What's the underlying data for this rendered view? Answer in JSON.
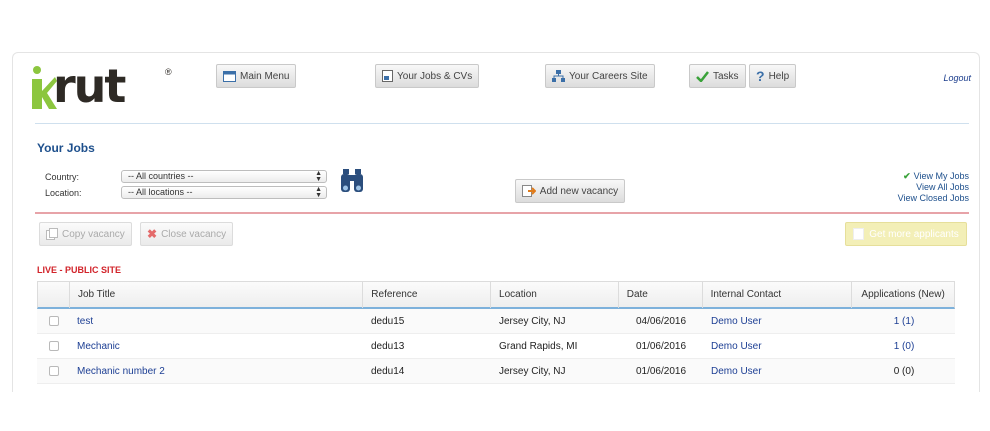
{
  "brand": {
    "logo_text": "rut",
    "logo_mark": "ik",
    "registered": "®"
  },
  "nav": {
    "main_menu": "Main Menu",
    "your_jobs": "Your Jobs & CVs",
    "careers_site": "Your Careers Site",
    "tasks": "Tasks",
    "help": "Help",
    "logout": "Logout"
  },
  "page": {
    "title": "Your Jobs"
  },
  "filters": {
    "country_label": "Country:",
    "country_value": "-- All countries --",
    "location_label": "Location:",
    "location_value": "-- All locations --"
  },
  "actions": {
    "add_new": "Add new vacancy",
    "copy": "Copy vacancy",
    "close": "Close vacancy",
    "get_more": "Get more applicants"
  },
  "links": {
    "view_my": "View My Jobs",
    "view_all": "View All Jobs",
    "view_closed": "View Closed Jobs"
  },
  "section": {
    "label": "LIVE - PUBLIC SITE"
  },
  "table": {
    "headers": [
      "Job Title",
      "Reference",
      "Location",
      "Date",
      "Internal Contact",
      "Applications (New)"
    ],
    "rows": [
      {
        "title": "test",
        "reference": "dedu15",
        "location": "Jersey City, NJ",
        "date": "04/06/2016",
        "contact": "Demo User",
        "applications": "1 (1)"
      },
      {
        "title": "Mechanic",
        "reference": "dedu13",
        "location": "Grand Rapids, MI",
        "date": "01/06/2016",
        "contact": "Demo User",
        "applications": "1 (0)"
      },
      {
        "title": "Mechanic number 2",
        "reference": "dedu14",
        "location": "Jersey City, NJ",
        "date": "01/06/2016",
        "contact": "Demo User",
        "applications": "0 (0)"
      }
    ]
  },
  "colors": {
    "brand_green": "#8cc63f",
    "link_blue": "#1d3f94",
    "live_red": "#d2232a",
    "table_rule": "#7db1db"
  }
}
